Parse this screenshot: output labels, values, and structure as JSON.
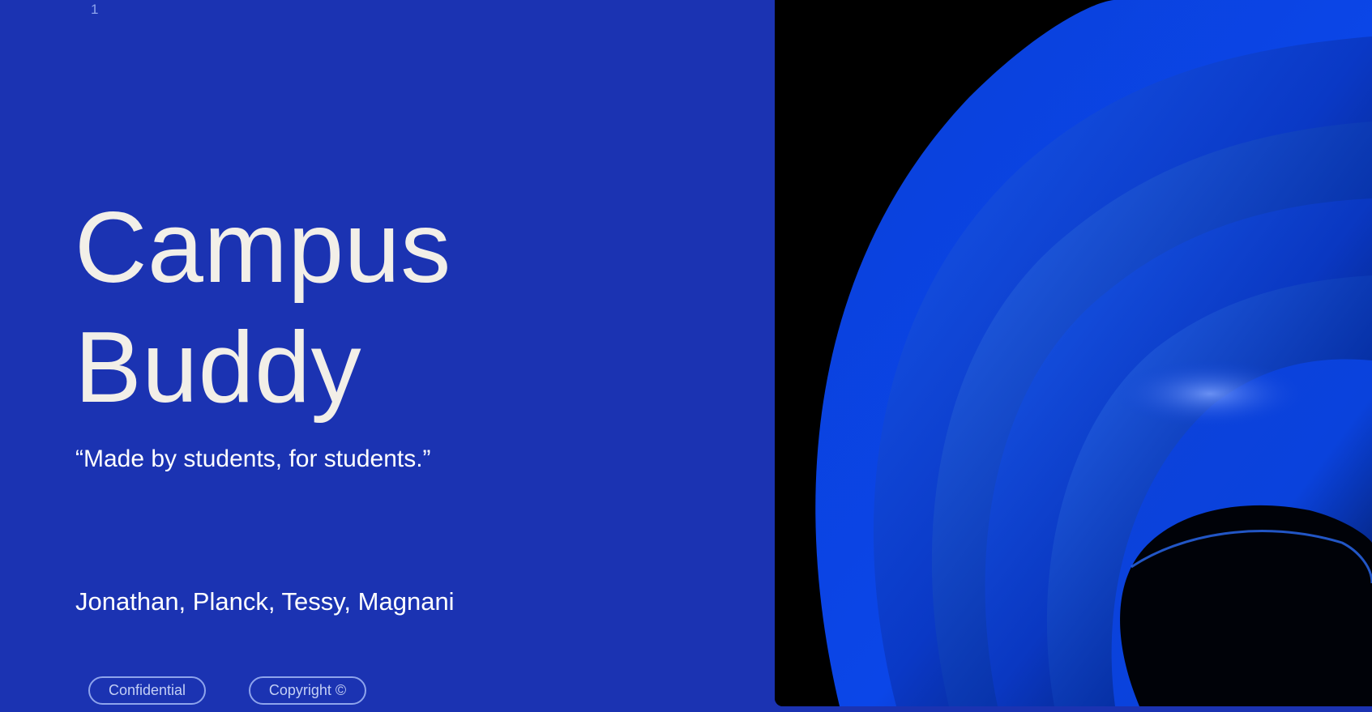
{
  "slide": {
    "number": "1",
    "title_line1": "Campus",
    "title_line2": "Buddy",
    "tagline": "“Made by students, for students.”",
    "authors": "Jonathan, Planck, Tessy, Magnani",
    "badges": {
      "confidential": "Confidential",
      "copyright": "Copyright ©"
    }
  },
  "colors": {
    "background": "#1b33b2",
    "title_text": "#f2efe8",
    "badge_border": "#8ea4ec",
    "art_background": "#000000",
    "art_accent": "#0a4be6"
  },
  "icons": {
    "hero_image": "abstract-blue-wave-image"
  }
}
